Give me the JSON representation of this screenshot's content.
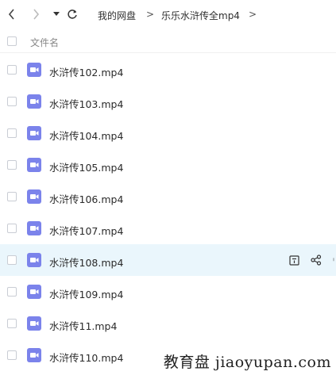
{
  "breadcrumb": {
    "items": [
      "我的网盘",
      "乐乐水浒传全mp4"
    ],
    "separator": ">"
  },
  "list_header": {
    "name_label": "文件名"
  },
  "files": [
    {
      "name": "水浒传102.mp4"
    },
    {
      "name": "水浒传103.mp4"
    },
    {
      "name": "水浒传104.mp4"
    },
    {
      "name": "水浒传105.mp4"
    },
    {
      "name": "水浒传106.mp4"
    },
    {
      "name": "水浒传107.mp4"
    },
    {
      "name": "水浒传108.mp4",
      "hovered": true
    },
    {
      "name": "水浒传109.mp4"
    },
    {
      "name": "水浒传11.mp4"
    },
    {
      "name": "水浒传110.mp4"
    }
  ],
  "colors": {
    "video_icon": "#7b83eb",
    "hover_row": "#eaf6fc"
  },
  "icons": [
    "back-arrow-icon",
    "forward-arrow-icon",
    "dropdown-caret-icon",
    "refresh-icon",
    "video-file-icon",
    "info-icon",
    "share-icon"
  ],
  "watermark": "教育盘 jiaoyupan.com"
}
